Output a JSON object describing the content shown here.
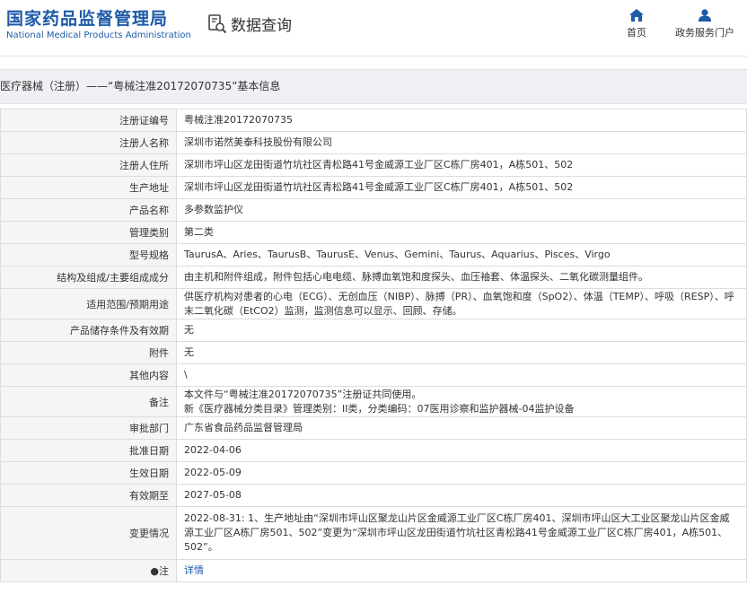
{
  "header": {
    "logo_cn": "国家药品监督管理局",
    "logo_en": "National Medical Products Administration",
    "search_title": "数据查询",
    "nav_home": "首页",
    "nav_service": "政务服务门户",
    "accent_color": "#1d5aa8"
  },
  "breadcrumb": "医疗器械（注册）——“粤械注准20172070735”基本信息",
  "rows": [
    {
      "label": "注册证编号",
      "value": "粤械注准20172070735"
    },
    {
      "label": "注册人名称",
      "value": "深圳市诺然美泰科技股份有限公司"
    },
    {
      "label": "注册人住所",
      "value": "深圳市坪山区龙田街道竹坑社区青松路41号金威源工业厂区C栋厂房401，A栋501、502"
    },
    {
      "label": "生产地址",
      "value": "深圳市坪山区龙田街道竹坑社区青松路41号金威源工业厂区C栋厂房401，A栋501、502"
    },
    {
      "label": "产品名称",
      "value": "多参数监护仪"
    },
    {
      "label": "管理类别",
      "value": "第二类"
    },
    {
      "label": "型号规格",
      "value": "TaurusA、Aries、TaurusB、TaurusE、Venus、Gemini、Taurus、Aquarius、Pisces、Virgo"
    },
    {
      "label": "结构及组成/主要组成成分",
      "value": "由主机和附件组成，附件包括心电电缆、脉搏血氧饱和度探头、血压袖套、体温探头、二氧化碳测量组件。"
    },
    {
      "label": "适用范围/预期用途",
      "value": "供医疗机构对患者的心电（ECG）、无创血压（NIBP）、脉搏（PR）、血氧饱和度（SpO2）、体温（TEMP）、呼吸（RESP）、呼末二氧化碳（EtCO2）监测，监测信息可以显示、回顾、存储。"
    },
    {
      "label": "产品储存条件及有效期",
      "value": "无"
    },
    {
      "label": "附件",
      "value": "无"
    },
    {
      "label": "其他内容",
      "value": "\\"
    },
    {
      "label": "备注",
      "value_line1": "本文件与“粤械注准20172070735”注册证共同使用。",
      "value_line2": "新《医疗器械分类目录》管理类别：II类，分类编码：07医用诊察和监护器械-04监护设备"
    },
    {
      "label": "审批部门",
      "value": "广东省食品药品监督管理局"
    },
    {
      "label": "批准日期",
      "value": "2022-04-06"
    },
    {
      "label": "生效日期",
      "value": "2022-05-09"
    },
    {
      "label": "有效期至",
      "value": "2027-05-08"
    },
    {
      "label": "变更情况",
      "value": "2022-08-31: 1、生产地址由“深圳市坪山区聚龙山片区金威源工业厂区C栋厂房401、深圳市坪山区大工业区聚龙山片区金威源工业厂区A栋厂房501、502”变更为“深圳市坪山区龙田街道竹坑社区青松路41号金威源工业厂区C栋厂房401，A栋501、502”。"
    },
    {
      "label": "注",
      "value": "详情"
    }
  ]
}
